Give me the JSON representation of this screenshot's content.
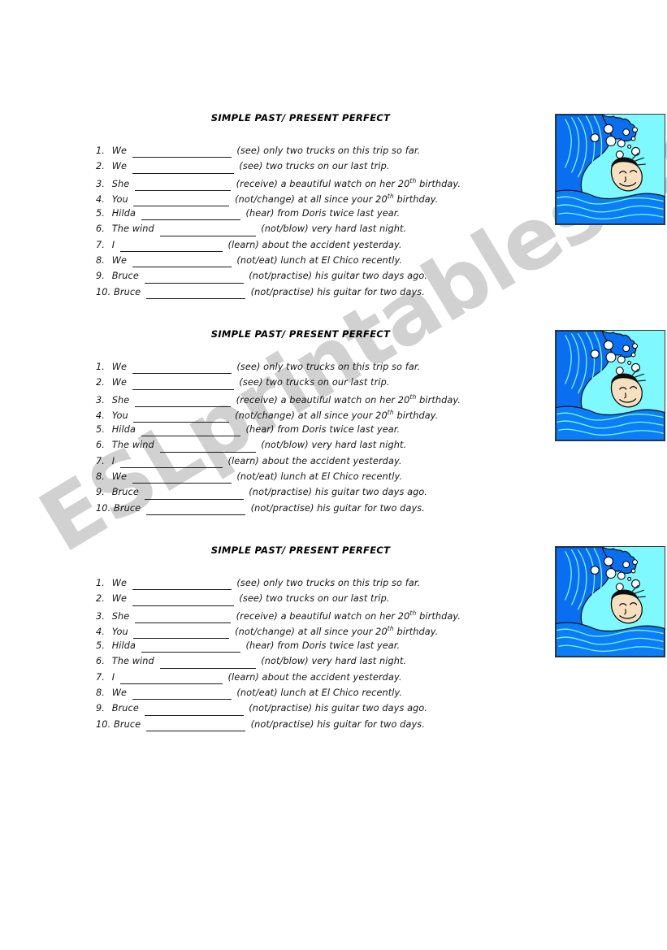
{
  "document": {
    "type": "esl-worksheet",
    "page_background": "#ffffff",
    "block_count": 3
  },
  "watermark": {
    "text": "ESLprintables.com",
    "color": "#c9c9c9",
    "rotation_deg": -31
  },
  "worksheet": {
    "title": "SIMPLE PAST/ PRESENT PERFECT",
    "questions": [
      {
        "num": "1.",
        "before": "We",
        "blank_width": 122,
        "after_open": "(see) only two trucks on this trip so far.",
        "sup": ""
      },
      {
        "num": "2.",
        "before": "We",
        "blank_width": 125,
        "after_open": "(see) two trucks on our last trip.",
        "sup": ""
      },
      {
        "num": "3.",
        "before": "She",
        "blank_width": 118,
        "after_open": "(receive) a beautiful watch on her 20",
        "sup": "th",
        "after_sup": " birthday."
      },
      {
        "num": "4.",
        "before": "You",
        "blank_width": 118,
        "after_open": "(not/change) at all since your 20",
        "sup": "th",
        "after_sup": " birthday."
      },
      {
        "num": "5.",
        "before": "Hilda",
        "blank_width": 122,
        "after_open": "(hear) from Doris twice last year.",
        "sup": ""
      },
      {
        "num": "6.",
        "before": "The wind",
        "blank_width": 118,
        "after_open": "(not/blow) very hard last night.",
        "sup": ""
      },
      {
        "num": "7.",
        "before": "I",
        "blank_width": 126,
        "after_open": "(learn) about the accident yesterday.",
        "sup": ""
      },
      {
        "num": "8.",
        "before": "We",
        "blank_width": 122,
        "after_open": "(not/eat) lunch at El Chico recently.",
        "sup": ""
      },
      {
        "num": "9.",
        "before": "Bruce",
        "blank_width": 122,
        "after_open": "(not/practise) his guitar two days ago.",
        "sup": ""
      },
      {
        "num": "10.",
        "before": "Bruce",
        "blank_width": 122,
        "after_open": "(not/practise) his guitar for two days.",
        "sup": ""
      }
    ]
  },
  "illustration": {
    "name": "wave-swimmer-illustration",
    "alt": "Cartoon of a boy swimming in front of a big breaking wave",
    "colors": {
      "sky": "#7df9ff",
      "wave_deep": "#0a6ef0",
      "wave_mid": "#0b7ef7",
      "swirl_line": "#7df9ff",
      "bubble": "#ffffff",
      "outline": "#0a0a0a",
      "skin": "#f7e0c0",
      "hair": "#101010",
      "border": "#3a3a3a"
    }
  }
}
